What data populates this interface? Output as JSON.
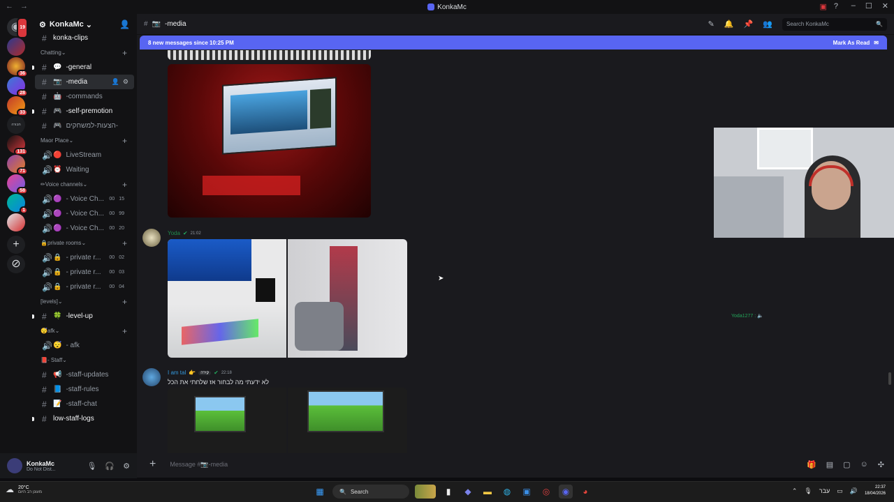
{
  "window": {
    "title": "KonkaMc",
    "nav": [
      "←",
      "→"
    ],
    "controls": [
      "–",
      "☐",
      "✕"
    ]
  },
  "servers": [
    {
      "name": "home-icon",
      "badge": "19"
    },
    {
      "name": "server-1",
      "badge": ""
    },
    {
      "name": "server-2",
      "badge": "36"
    },
    {
      "name": "server-3",
      "badge": "28"
    },
    {
      "name": "server-4",
      "badge": "33"
    },
    {
      "name": "server-5",
      "badge": ""
    },
    {
      "name": "server-6",
      "badge": "131"
    },
    {
      "name": "server-7",
      "badge": "71"
    },
    {
      "name": "server-8",
      "badge": "58"
    },
    {
      "name": "server-9",
      "badge": "1"
    },
    {
      "name": "server-10",
      "badge": ""
    }
  ],
  "guild": {
    "name": "KonkaMc",
    "chevron": "⌄"
  },
  "channels": {
    "top": {
      "label": "konka-clips"
    },
    "cat_chatting": "Chatting",
    "general": "-general",
    "media": "-media",
    "commands": "-commands",
    "self_promotion": "-self-premotion",
    "hebrew": "הצעות-למשחקים-",
    "cat_maor": "Maor Place",
    "livestream": "LiveStream",
    "waiting": "Waiting",
    "cat_voice": "Voice channels",
    "voice": [
      {
        "label": "- Voice Ch...",
        "a": "00",
        "b": "15"
      },
      {
        "label": "- Voice Ch...",
        "a": "00",
        "b": "99"
      },
      {
        "label": "- Voice Ch...",
        "a": "00",
        "b": "20"
      }
    ],
    "cat_private": "private rooms",
    "private": [
      {
        "label": "- private r...",
        "a": "00",
        "b": "02"
      },
      {
        "label": "- private r...",
        "a": "00",
        "b": "03"
      },
      {
        "label": "- private r...",
        "a": "00",
        "b": "04"
      }
    ],
    "cat_levels": "[levels]",
    "level_up": "-level-up",
    "cat_afk": "afk",
    "afk": "- afk",
    "cat_staff": "- Staff",
    "staff_updates": "-staff-updates",
    "staff_rules": "-staff-rules",
    "staff_chat": "-staff-chat",
    "low_staff_logs": "low-staff-logs"
  },
  "user": {
    "name": "KonkaMc",
    "status": "Do Not Dist..."
  },
  "topbar": {
    "channel": "-media",
    "search_placeholder": "Search KonkaMc"
  },
  "banner": {
    "text": "8 new messages since 10:25 PM",
    "action": "Mark As Read"
  },
  "messages": [
    {
      "author": "Yoda",
      "time": "21:02",
      "text": ""
    },
    {
      "author": "I am tal",
      "tag": "קירה",
      "time": "22:18",
      "text": "לא ידעתי מה לבחור אז שלחתי את הכל"
    }
  ],
  "voice_user": "Yoda1277 :",
  "composer": {
    "placeholder": "Message #📷-media"
  },
  "taskbar": {
    "temp": "20°C",
    "weather": "מעונן רב היום",
    "search": "Search",
    "lang": "עבר",
    "time": "22:37",
    "date": "18/04/2026"
  }
}
